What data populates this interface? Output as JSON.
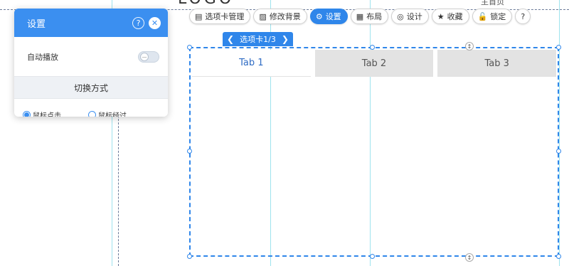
{
  "page": {
    "logo_text": "LOGO",
    "home_link": "主首页"
  },
  "toolbar": {
    "items": [
      {
        "icon": "tab-manage-icon",
        "glyph": "▤",
        "label": "选项卡管理"
      },
      {
        "icon": "image-icon",
        "glyph": "▨",
        "label": "修改背景"
      },
      {
        "icon": "gear-icon",
        "glyph": "⚙",
        "label": "设置",
        "active": true
      },
      {
        "icon": "layout-icon",
        "glyph": "▦",
        "label": "布局"
      },
      {
        "icon": "design-icon",
        "glyph": "◎",
        "label": "设计"
      },
      {
        "icon": "star-icon",
        "glyph": "★",
        "label": "收藏"
      },
      {
        "icon": "lock-icon",
        "glyph": "🔓",
        "label": "锁定"
      }
    ],
    "help_glyph": "?"
  },
  "pager": {
    "label": "选项卡1/3",
    "prev_glyph": "❮",
    "next_glyph": "❯"
  },
  "module": {
    "tabs": [
      {
        "label": "Tab 1",
        "active": true
      },
      {
        "label": "Tab 2",
        "active": false
      },
      {
        "label": "Tab 3",
        "active": false
      }
    ],
    "resize_glyph": "↕"
  },
  "settings_panel": {
    "title": "设置",
    "help_glyph": "?",
    "close_glyph": "✕",
    "autoplay_label": "自动播放",
    "autoplay_on": false,
    "switch_section_title": "切换方式",
    "switch_options": [
      {
        "label": "鼠标点击",
        "checked": true
      },
      {
        "label": "鼠标经过",
        "checked": false
      }
    ]
  },
  "colors": {
    "accent": "#2f86ea",
    "panel_header": "#3b8ff0",
    "tab_inactive_bg": "#e3e3e3",
    "guide_line": "#9fe3ee"
  }
}
